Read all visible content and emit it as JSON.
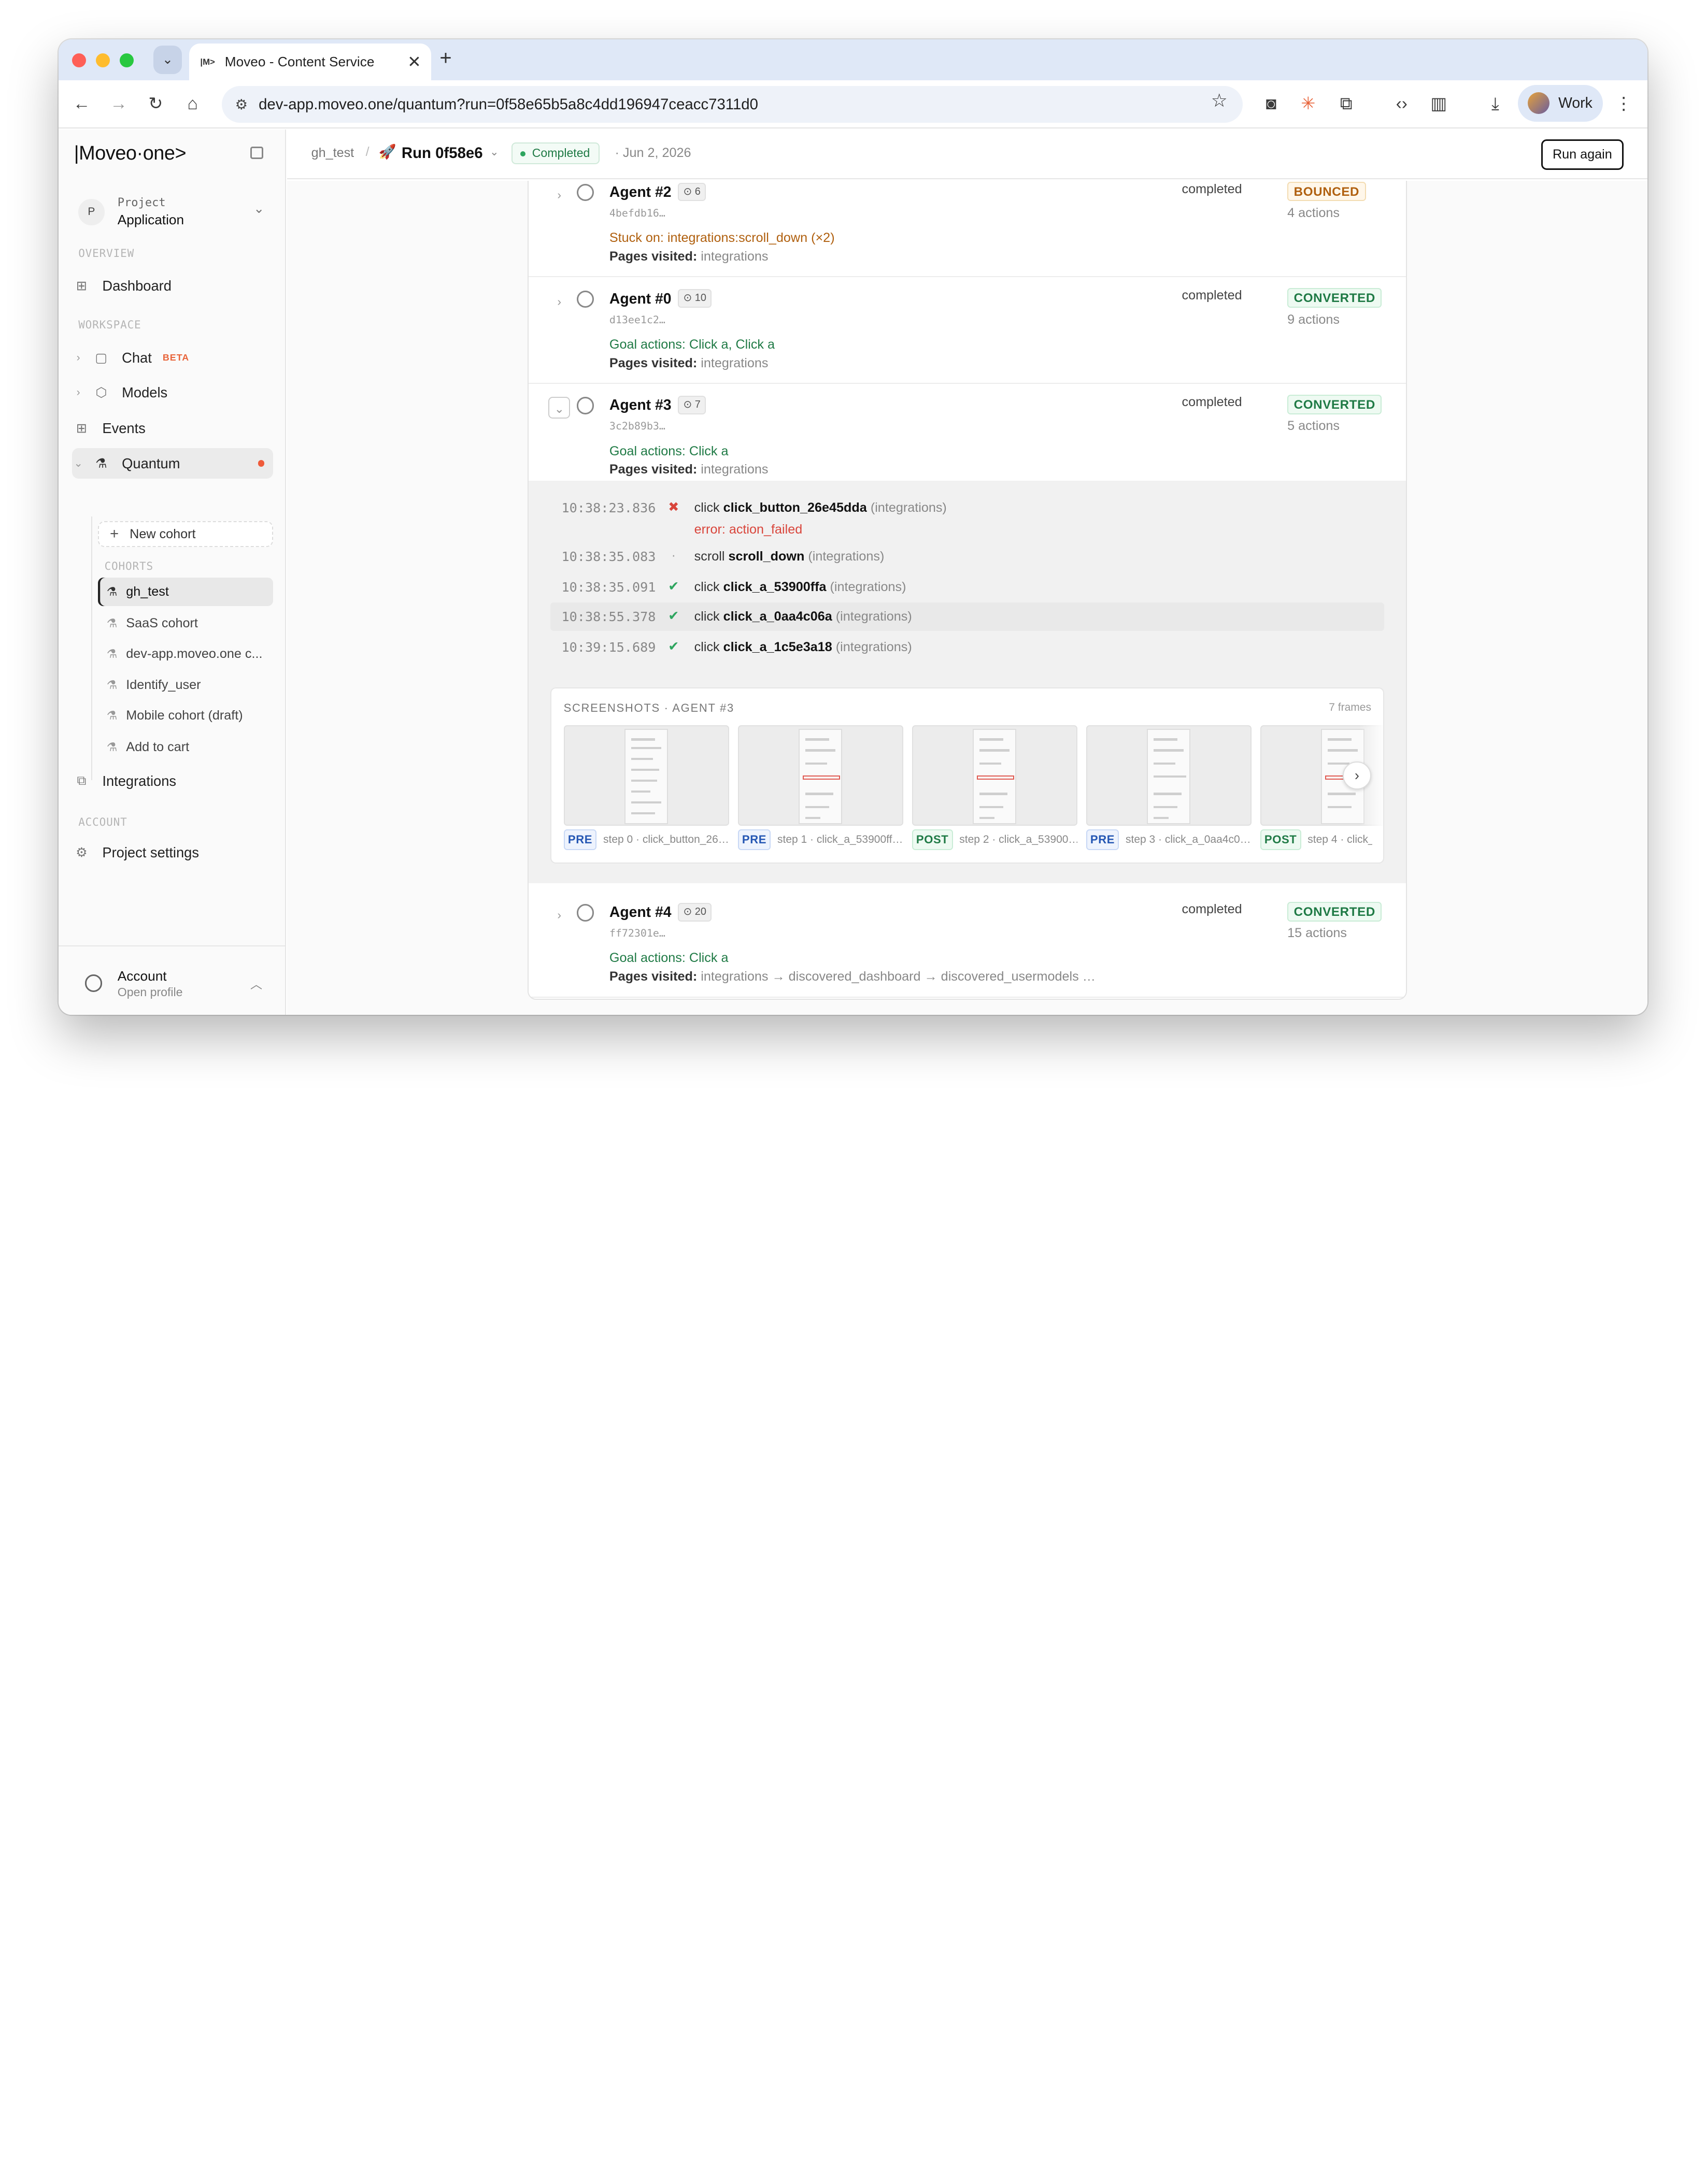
{
  "browser": {
    "tab_icon_text": "|M>",
    "tab_title": "Moveo - Content Service",
    "url": "dev-app.moveo.one/quantum?run=0f58e65b5a8c4dd196947ceacc7311d0",
    "profile_label": "Work"
  },
  "sidebar": {
    "logo": "|Moveo·one>",
    "project_label": "Project",
    "project_name": "Application",
    "project_initial": "P",
    "section_overview": "OVERVIEW",
    "section_workspace": "WORKSPACE",
    "section_account": "ACCOUNT",
    "cohorts_label": "COHORTS",
    "dashboard": "Dashboard",
    "chat": "Chat",
    "chat_badge": "BETA",
    "models": "Models",
    "events": "Events",
    "quantum": "Quantum",
    "new_cohort": "New cohort",
    "cohorts": [
      "gh_test",
      "SaaS cohort",
      "dev-app.moveo.one c...",
      "Identify_user",
      "Mobile cohort (draft)",
      "Add to cart"
    ],
    "integrations": "Integrations",
    "project_settings": "Project settings",
    "account_title": "Account",
    "account_sub": "Open profile"
  },
  "header": {
    "crumb": "gh_test",
    "run_title": "Run 0f58e6",
    "status": "Completed",
    "date": "· Jun 2, 2026",
    "run_again": "Run again"
  },
  "agents": [
    {
      "name": "Agent #2",
      "count": "6",
      "hash": "4befdb16…",
      "line1_label": "Stuck on:",
      "line1_value": "integrations:scroll_down (×2)",
      "pages_label": "Pages visited:",
      "pages": "integrations",
      "status": "completed",
      "outcome": "BOUNCED",
      "actions": "4 actions"
    },
    {
      "name": "Agent #0",
      "count": "10",
      "hash": "d13ee1c2…",
      "line1_label": "Goal actions:",
      "line1_value": "Click a, Click a",
      "pages_label": "Pages visited:",
      "pages": "integrations",
      "status": "completed",
      "outcome": "CONVERTED",
      "actions": "9 actions"
    },
    {
      "name": "Agent #3",
      "count": "7",
      "hash": "3c2b89b3…",
      "line1_label": "Goal actions:",
      "line1_value": "Click a",
      "pages_label": "Pages visited:",
      "pages": "integrations",
      "status": "completed",
      "outcome": "CONVERTED",
      "actions": "5 actions"
    },
    {
      "name": "Agent #4",
      "count": "20",
      "hash": "ff72301e…",
      "line1_label": "Goal actions:",
      "line1_value": "Click a",
      "pages_label": "Pages visited:",
      "pages": "integrations → discovered_dashboard → discovered_usermodels …",
      "status": "completed",
      "outcome": "CONVERTED",
      "actions": "15 actions"
    }
  ],
  "events": [
    {
      "time": "10:38:23.836",
      "mark": "✖",
      "verb": "click",
      "target": "click_button_26e45dda",
      "page": "(integrations)",
      "error": "error: action_failed"
    },
    {
      "time": "10:38:35.083",
      "mark": "·",
      "verb": "scroll",
      "target": "scroll_down",
      "page": "(integrations)"
    },
    {
      "time": "10:38:35.091",
      "mark": "✔",
      "verb": "click",
      "target": "click_a_53900ffa",
      "page": "(integrations)"
    },
    {
      "time": "10:38:55.378",
      "mark": "✔",
      "verb": "click",
      "target": "click_a_0aa4c06a",
      "page": "(integrations)"
    },
    {
      "time": "10:39:15.689",
      "mark": "✔",
      "verb": "click",
      "target": "click_a_1c5e3a18",
      "page": "(integrations)"
    }
  ],
  "screenshots": {
    "label": "SCREENSHOTS · AGENT #3",
    "frames": "7 frames",
    "items": [
      {
        "tag": "PRE",
        "caption": "step 0 · click_button_26…"
      },
      {
        "tag": "PRE",
        "caption": "step 1 · click_a_53900ff…"
      },
      {
        "tag": "POST",
        "caption": "step 2 · click_a_53900…"
      },
      {
        "tag": "PRE",
        "caption": "step 3 · click_a_0aa4c0…"
      },
      {
        "tag": "POST",
        "caption": "step 4 · click_"
      }
    ]
  },
  "colors": {
    "success": "#1f7a45",
    "bounce": "#b0600f",
    "error": "#d9453b",
    "accent_dot": "#ef5b3a"
  }
}
